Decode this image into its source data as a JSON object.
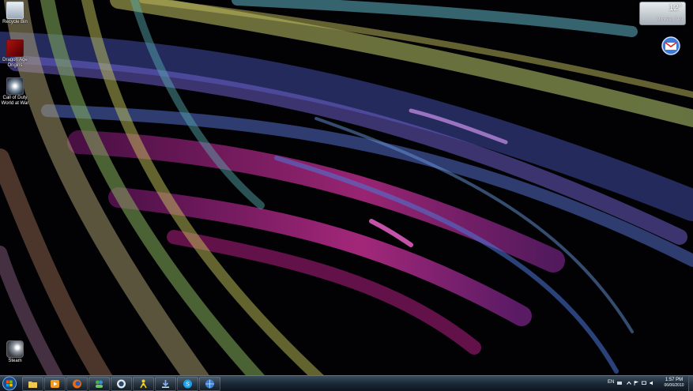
{
  "desktop": {
    "icons": [
      {
        "label": "Recycle Bin",
        "icon": "recycle-bin-icon"
      },
      {
        "label": "Dragon Age Origins",
        "icon": "dragon-age-icon"
      },
      {
        "label": "Call of Duty World at War",
        "icon": "call-of-duty-icon"
      },
      {
        "label": "Steam",
        "icon": "steam-icon"
      }
    ]
  },
  "weather_gadget": {
    "temperature": "12°",
    "location": "Montréal, CAN"
  },
  "taskbar": {
    "pinned": [
      "folder-icon",
      "media-player-icon",
      "firefox-icon",
      "messenger-icon",
      "tweetdeck-icon",
      "aim-icon",
      "download-icon",
      "skype-icon",
      "network-icon"
    ],
    "tray": {
      "language": "EN",
      "time": "1:57 PM",
      "date": "06/06/2010"
    }
  },
  "colors": {
    "taskbar": "#1b2836",
    "accent_magenta": "#ff2fb4",
    "accent_blue": "#5aa8ff"
  }
}
